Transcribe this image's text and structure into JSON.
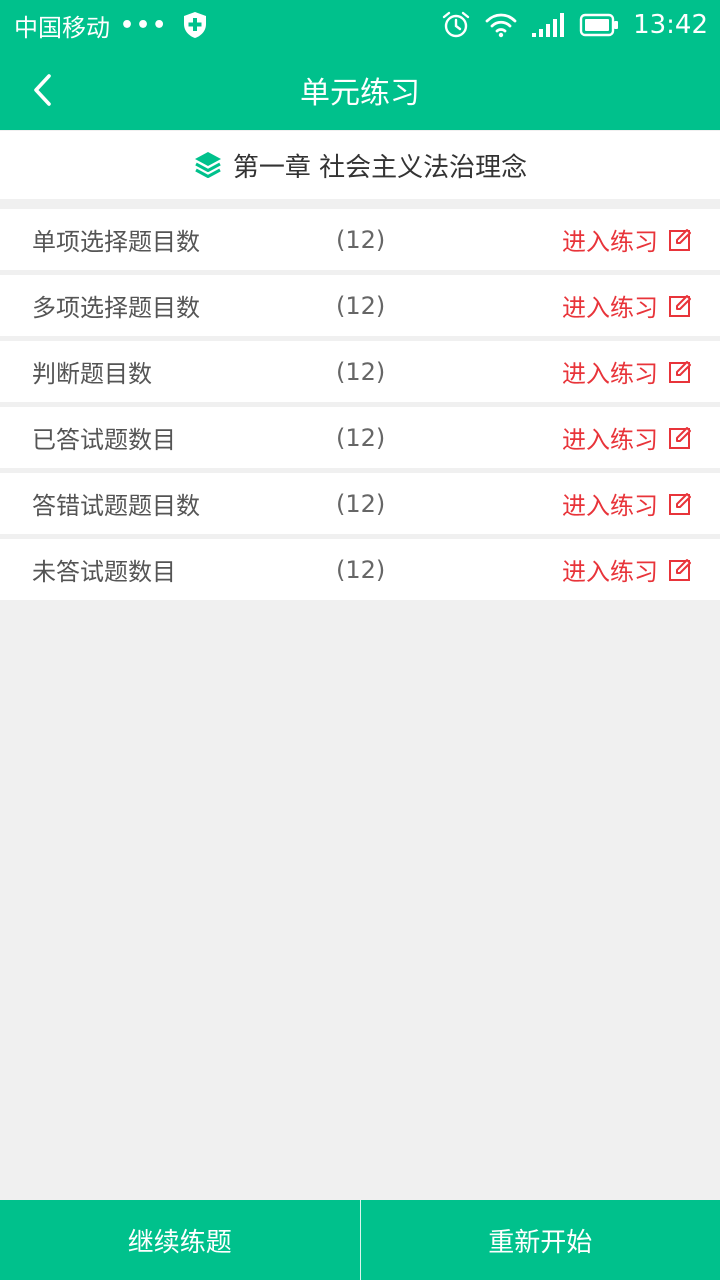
{
  "status_bar": {
    "carrier": "中国移动",
    "dots": "•••",
    "time": "13:42",
    "icons": [
      "shield-plus-icon",
      "alarm-icon",
      "wifi-icon",
      "signal-icon",
      "battery-icon"
    ]
  },
  "nav": {
    "title": "单元练习",
    "back_icon": "chevron-left-icon"
  },
  "chapter": {
    "icon": "layers-icon",
    "title": "第一章 社会主义法治理念"
  },
  "rows": [
    {
      "label": "单项选择题目数",
      "count": "(12)",
      "action": "进入练习"
    },
    {
      "label": "多项选择题目数",
      "count": "(12)",
      "action": "进入练习"
    },
    {
      "label": "判断题目数",
      "count": "(12)",
      "action": "进入练习"
    },
    {
      "label": "已答试题数目",
      "count": "(12)",
      "action": "进入练习"
    },
    {
      "label": "答错试题题目数",
      "count": "(12)",
      "action": "进入练习"
    },
    {
      "label": "未答试题数目",
      "count": "(12)",
      "action": "进入练习"
    }
  ],
  "bottom": {
    "continue_label": "继续练题",
    "restart_label": "重新开始"
  },
  "colors": {
    "primary": "#00c18c",
    "action": "#e8343a",
    "background": "#f0f0f0"
  }
}
